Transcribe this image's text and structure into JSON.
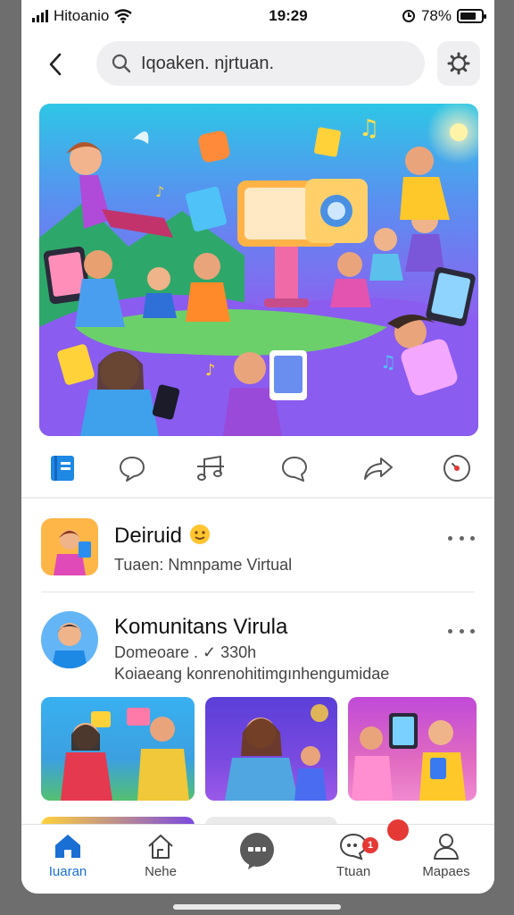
{
  "status": {
    "carrier": "Hitoanio",
    "time": "19:29",
    "battery": "78%"
  },
  "search": {
    "query": "Iqoaken. njrtuan."
  },
  "action_bar": {
    "icons": [
      "book-icon",
      "chat-bubble-icon",
      "music-note-icon",
      "comment-icon",
      "share-icon",
      "clock-icon"
    ]
  },
  "posts": [
    {
      "title": "Deiruid",
      "subtitle": "Tuaen: Nmnpame Virtual"
    },
    {
      "title": "Komunitans Virula",
      "meta": "Domeoare . ✓ 330h",
      "description": "Koiaeang konrenohitimgınhengumidae"
    }
  ],
  "tabs": [
    {
      "label": "Iuaran",
      "icon": "home-icon",
      "active": true
    },
    {
      "label": "Nehe",
      "icon": "house-outline-icon",
      "active": false
    },
    {
      "label": "",
      "icon": "chat-icon",
      "active": false
    },
    {
      "label": "Ttuan",
      "icon": "message-icon",
      "active": false,
      "badge": "1"
    },
    {
      "label": "Mapaes",
      "icon": "profile-icon",
      "active": false
    }
  ],
  "colors": {
    "accent": "#1a6fd4",
    "badge": "#e53935",
    "hero_top": "#2ec6e6",
    "hero_bottom": "#6a3fd8"
  }
}
